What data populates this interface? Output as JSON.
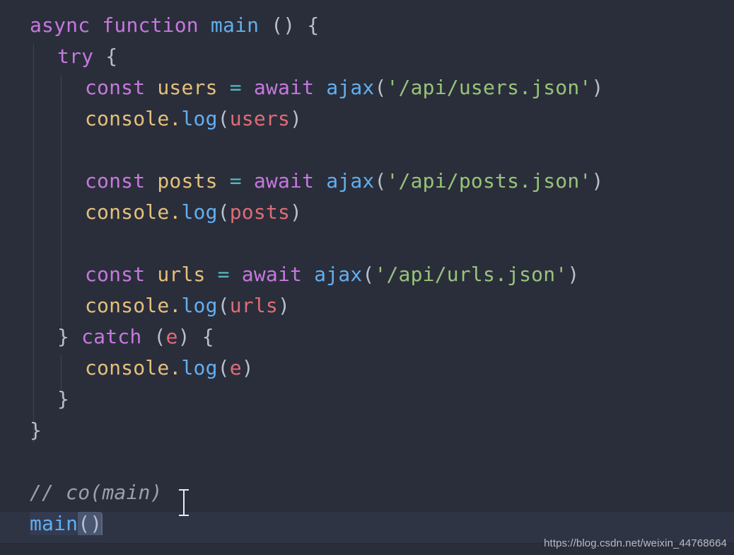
{
  "editor": {
    "theme_name": "one-dark",
    "background_color": "#2a2e3b",
    "language": "javascript",
    "font_size_px": 28,
    "line_height_px": 44,
    "colors": {
      "keyword": "#c678dd",
      "function": "#61afef",
      "variable": "#e5c07b",
      "string": "#98c379",
      "operator": "#56b6c2",
      "parameter": "#e06c75",
      "punctuation": "#b9bfcc",
      "comment": "#9aa0ad",
      "current_line": "#2f3444",
      "indent_guide": "#3d4356",
      "selection": "#333b52",
      "bracket_match": "#4a5570"
    }
  },
  "code": {
    "lines": [
      {
        "indent": 0,
        "tokens": [
          {
            "text": "async",
            "kind": "keyword"
          },
          {
            "text": " ",
            "kind": "plain"
          },
          {
            "text": "function",
            "kind": "keyword"
          },
          {
            "text": " ",
            "kind": "plain"
          },
          {
            "text": "main",
            "kind": "func"
          },
          {
            "text": " ",
            "kind": "plain"
          },
          {
            "text": "()",
            "kind": "punct"
          },
          {
            "text": " ",
            "kind": "plain"
          },
          {
            "text": "{",
            "kind": "punct"
          }
        ]
      },
      {
        "indent": 1,
        "tokens": [
          {
            "text": "try",
            "kind": "keyword"
          },
          {
            "text": " ",
            "kind": "plain"
          },
          {
            "text": "{",
            "kind": "punct"
          }
        ]
      },
      {
        "indent": 2,
        "tokens": [
          {
            "text": "const",
            "kind": "keyword"
          },
          {
            "text": " ",
            "kind": "plain"
          },
          {
            "text": "users",
            "kind": "var"
          },
          {
            "text": " ",
            "kind": "plain"
          },
          {
            "text": "=",
            "kind": "op"
          },
          {
            "text": " ",
            "kind": "plain"
          },
          {
            "text": "await",
            "kind": "keyword"
          },
          {
            "text": " ",
            "kind": "plain"
          },
          {
            "text": "ajax",
            "kind": "func"
          },
          {
            "text": "(",
            "kind": "punct"
          },
          {
            "text": "'/api/users.json'",
            "kind": "string"
          },
          {
            "text": ")",
            "kind": "punct"
          }
        ]
      },
      {
        "indent": 2,
        "tokens": [
          {
            "text": "console",
            "kind": "var"
          },
          {
            "text": ".",
            "kind": "var"
          },
          {
            "text": "log",
            "kind": "prop"
          },
          {
            "text": "(",
            "kind": "punct"
          },
          {
            "text": "users",
            "kind": "param"
          },
          {
            "text": ")",
            "kind": "punct"
          }
        ]
      },
      {
        "indent": 2,
        "tokens": []
      },
      {
        "indent": 2,
        "tokens": [
          {
            "text": "const",
            "kind": "keyword"
          },
          {
            "text": " ",
            "kind": "plain"
          },
          {
            "text": "posts",
            "kind": "var"
          },
          {
            "text": " ",
            "kind": "plain"
          },
          {
            "text": "=",
            "kind": "op"
          },
          {
            "text": " ",
            "kind": "plain"
          },
          {
            "text": "await",
            "kind": "keyword"
          },
          {
            "text": " ",
            "kind": "plain"
          },
          {
            "text": "ajax",
            "kind": "func"
          },
          {
            "text": "(",
            "kind": "punct"
          },
          {
            "text": "'/api/posts.json'",
            "kind": "string"
          },
          {
            "text": ")",
            "kind": "punct"
          }
        ]
      },
      {
        "indent": 2,
        "tokens": [
          {
            "text": "console",
            "kind": "var"
          },
          {
            "text": ".",
            "kind": "var"
          },
          {
            "text": "log",
            "kind": "prop"
          },
          {
            "text": "(",
            "kind": "punct"
          },
          {
            "text": "posts",
            "kind": "param"
          },
          {
            "text": ")",
            "kind": "punct"
          }
        ]
      },
      {
        "indent": 2,
        "tokens": []
      },
      {
        "indent": 2,
        "tokens": [
          {
            "text": "const",
            "kind": "keyword"
          },
          {
            "text": " ",
            "kind": "plain"
          },
          {
            "text": "urls",
            "kind": "var"
          },
          {
            "text": " ",
            "kind": "plain"
          },
          {
            "text": "=",
            "kind": "op"
          },
          {
            "text": " ",
            "kind": "plain"
          },
          {
            "text": "await",
            "kind": "keyword"
          },
          {
            "text": " ",
            "kind": "plain"
          },
          {
            "text": "ajax",
            "kind": "func"
          },
          {
            "text": "(",
            "kind": "punct"
          },
          {
            "text": "'/api/urls.json'",
            "kind": "string"
          },
          {
            "text": ")",
            "kind": "punct"
          }
        ]
      },
      {
        "indent": 2,
        "tokens": [
          {
            "text": "console",
            "kind": "var"
          },
          {
            "text": ".",
            "kind": "var"
          },
          {
            "text": "log",
            "kind": "prop"
          },
          {
            "text": "(",
            "kind": "punct"
          },
          {
            "text": "urls",
            "kind": "param"
          },
          {
            "text": ")",
            "kind": "punct"
          }
        ]
      },
      {
        "indent": 1,
        "tokens": [
          {
            "text": "}",
            "kind": "punct"
          },
          {
            "text": " ",
            "kind": "plain"
          },
          {
            "text": "catch",
            "kind": "keyword"
          },
          {
            "text": " ",
            "kind": "plain"
          },
          {
            "text": "(",
            "kind": "punct"
          },
          {
            "text": "e",
            "kind": "param"
          },
          {
            "text": ")",
            "kind": "punct"
          },
          {
            "text": " ",
            "kind": "plain"
          },
          {
            "text": "{",
            "kind": "punct"
          }
        ]
      },
      {
        "indent": 2,
        "tokens": [
          {
            "text": "console",
            "kind": "var"
          },
          {
            "text": ".",
            "kind": "var"
          },
          {
            "text": "log",
            "kind": "prop"
          },
          {
            "text": "(",
            "kind": "punct"
          },
          {
            "text": "e",
            "kind": "param"
          },
          {
            "text": ")",
            "kind": "punct"
          }
        ]
      },
      {
        "indent": 1,
        "tokens": [
          {
            "text": "}",
            "kind": "punct"
          }
        ]
      },
      {
        "indent": 0,
        "tokens": [
          {
            "text": "}",
            "kind": "punct"
          }
        ]
      },
      {
        "indent": 0,
        "tokens": []
      },
      {
        "indent": 0,
        "tokens": [
          {
            "text": "// co(main)",
            "kind": "comment"
          }
        ]
      },
      {
        "indent": 0,
        "highlight": true,
        "tokens": [
          {
            "text": "main",
            "kind": "func",
            "sel": "soft"
          },
          {
            "text": "()",
            "kind": "punct",
            "sel": "bracket"
          }
        ]
      }
    ]
  },
  "cursor": {
    "mouse_pointer": "text-ibeam-cursor",
    "caret_line_index": 16,
    "caret_column": 6
  },
  "watermark": {
    "text": "https://blog.csdn.net/weixin_44768664"
  }
}
